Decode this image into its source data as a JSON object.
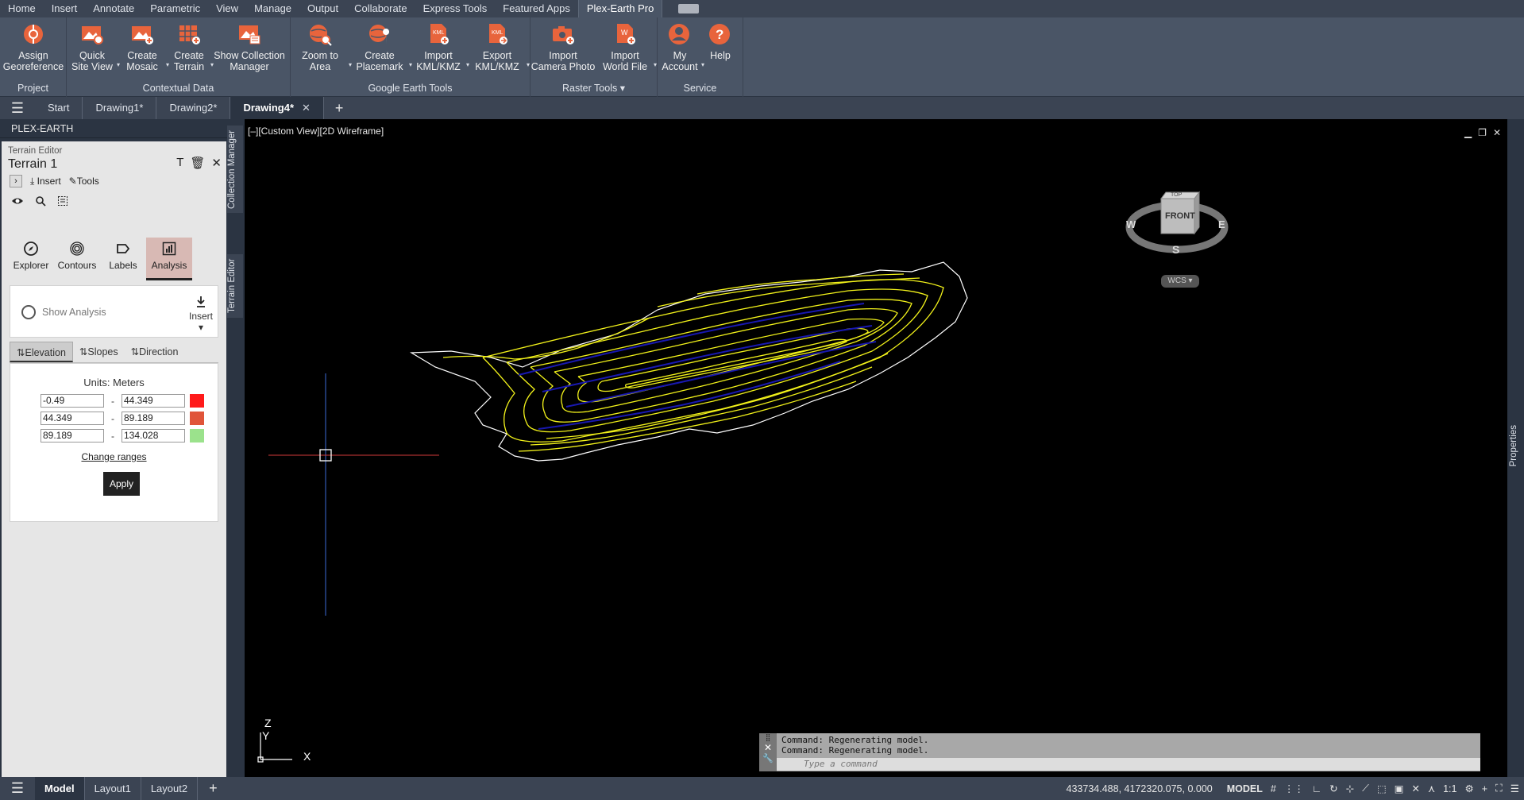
{
  "menu": {
    "tabs": [
      "Home",
      "Insert",
      "Annotate",
      "Parametric",
      "View",
      "Manage",
      "Output",
      "Collaborate",
      "Express Tools",
      "Featured Apps",
      "Plex-Earth Pro"
    ]
  },
  "ribbon": {
    "panels": [
      {
        "title": "Project",
        "buttons": [
          "Assign\nGeoreference"
        ]
      },
      {
        "title": "Contextual Data",
        "buttons": [
          "Quick\nSite View",
          "Create\nMosaic",
          "Create\nTerrain",
          "Show Collection\nManager"
        ]
      },
      {
        "title": "Google Earth Tools",
        "buttons": [
          "Zoom to\nArea",
          "Create\nPlacemark",
          "Import\nKML/KMZ",
          "Export\nKML/KMZ"
        ]
      },
      {
        "title": "Raster Tools",
        "buttons": [
          "Import\nCamera Photo",
          "Import\nWorld File"
        ]
      },
      {
        "title": "Service",
        "buttons": [
          "My\nAccount",
          "Help"
        ]
      }
    ],
    "accent": "#e8643c"
  },
  "doctabs": {
    "start": "Start",
    "tabs": [
      "Drawing1*",
      "Drawing2*",
      "Drawing4*"
    ]
  },
  "palette": {
    "header": "PLEX-EARTH",
    "editor_label": "Terrain Editor",
    "terrain_name": "Terrain 1",
    "insert": "Insert",
    "tools": "Tools",
    "nav": [
      "Explorer",
      "Contours",
      "Labels",
      "Analysis"
    ],
    "show_analysis": "Show Analysis",
    "insert_btn": "Insert",
    "subtabs": [
      "Elevation",
      "Slopes",
      "Direction"
    ],
    "units": "Units: Meters",
    "ranges": [
      {
        "from": "-0.49",
        "to": "44.349",
        "color": "#ff1a1a"
      },
      {
        "from": "44.349",
        "to": "89.189",
        "color": "#e0553a"
      },
      {
        "from": "89.189",
        "to": "134.028",
        "color": "#9be28c"
      }
    ],
    "change_ranges": "Change ranges",
    "apply": "Apply",
    "side_tabs": [
      "Collection Manager",
      "Terrain Editor"
    ]
  },
  "viewport": {
    "label": "[–][Custom View][2D Wireframe]",
    "viewcube": {
      "top": "TOP",
      "front": "FRONT",
      "w": "W",
      "e": "E",
      "s": "S",
      "wcs": "WCS"
    },
    "ucs": {
      "x": "X",
      "y": "Y",
      "z": "Z"
    },
    "contour_color": "#f2f21a",
    "water_color": "#1818b0"
  },
  "command": {
    "lines": [
      "Command: Regenerating model.",
      "Command: Regenerating model."
    ],
    "placeholder": "Type a command"
  },
  "right_tab": "Properties",
  "status": {
    "layouts": [
      "Model",
      "Layout1",
      "Layout2"
    ],
    "coords": "433734.488, 4172320.075, 0.000",
    "model": "MODEL",
    "scale": "1:1"
  }
}
